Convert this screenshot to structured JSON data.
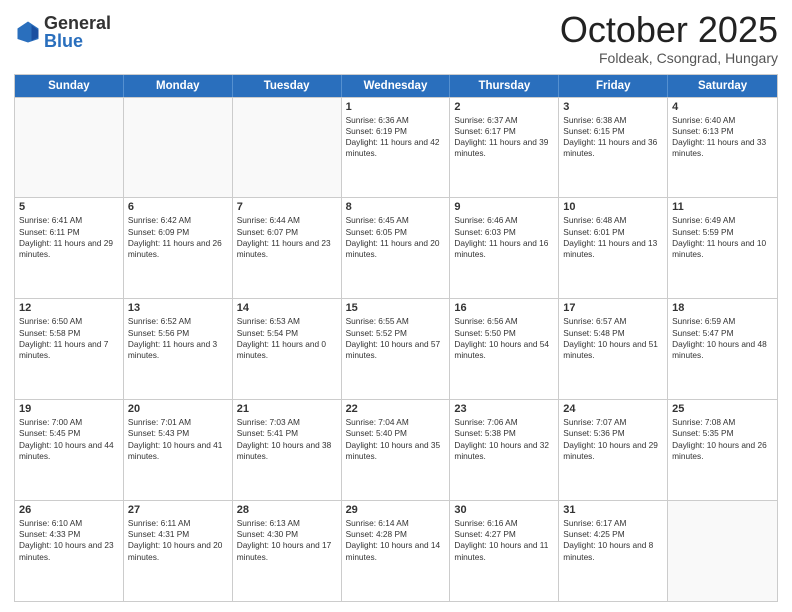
{
  "logo": {
    "general": "General",
    "blue": "Blue"
  },
  "header": {
    "month": "October 2025",
    "location": "Foldeak, Csongrad, Hungary"
  },
  "days": [
    "Sunday",
    "Monday",
    "Tuesday",
    "Wednesday",
    "Thursday",
    "Friday",
    "Saturday"
  ],
  "weeks": [
    [
      {
        "day": "",
        "sunrise": "",
        "sunset": "",
        "daylight": ""
      },
      {
        "day": "",
        "sunrise": "",
        "sunset": "",
        "daylight": ""
      },
      {
        "day": "",
        "sunrise": "",
        "sunset": "",
        "daylight": ""
      },
      {
        "day": "1",
        "sunrise": "Sunrise: 6:36 AM",
        "sunset": "Sunset: 6:19 PM",
        "daylight": "Daylight: 11 hours and 42 minutes."
      },
      {
        "day": "2",
        "sunrise": "Sunrise: 6:37 AM",
        "sunset": "Sunset: 6:17 PM",
        "daylight": "Daylight: 11 hours and 39 minutes."
      },
      {
        "day": "3",
        "sunrise": "Sunrise: 6:38 AM",
        "sunset": "Sunset: 6:15 PM",
        "daylight": "Daylight: 11 hours and 36 minutes."
      },
      {
        "day": "4",
        "sunrise": "Sunrise: 6:40 AM",
        "sunset": "Sunset: 6:13 PM",
        "daylight": "Daylight: 11 hours and 33 minutes."
      }
    ],
    [
      {
        "day": "5",
        "sunrise": "Sunrise: 6:41 AM",
        "sunset": "Sunset: 6:11 PM",
        "daylight": "Daylight: 11 hours and 29 minutes."
      },
      {
        "day": "6",
        "sunrise": "Sunrise: 6:42 AM",
        "sunset": "Sunset: 6:09 PM",
        "daylight": "Daylight: 11 hours and 26 minutes."
      },
      {
        "day": "7",
        "sunrise": "Sunrise: 6:44 AM",
        "sunset": "Sunset: 6:07 PM",
        "daylight": "Daylight: 11 hours and 23 minutes."
      },
      {
        "day": "8",
        "sunrise": "Sunrise: 6:45 AM",
        "sunset": "Sunset: 6:05 PM",
        "daylight": "Daylight: 11 hours and 20 minutes."
      },
      {
        "day": "9",
        "sunrise": "Sunrise: 6:46 AM",
        "sunset": "Sunset: 6:03 PM",
        "daylight": "Daylight: 11 hours and 16 minutes."
      },
      {
        "day": "10",
        "sunrise": "Sunrise: 6:48 AM",
        "sunset": "Sunset: 6:01 PM",
        "daylight": "Daylight: 11 hours and 13 minutes."
      },
      {
        "day": "11",
        "sunrise": "Sunrise: 6:49 AM",
        "sunset": "Sunset: 5:59 PM",
        "daylight": "Daylight: 11 hours and 10 minutes."
      }
    ],
    [
      {
        "day": "12",
        "sunrise": "Sunrise: 6:50 AM",
        "sunset": "Sunset: 5:58 PM",
        "daylight": "Daylight: 11 hours and 7 minutes."
      },
      {
        "day": "13",
        "sunrise": "Sunrise: 6:52 AM",
        "sunset": "Sunset: 5:56 PM",
        "daylight": "Daylight: 11 hours and 3 minutes."
      },
      {
        "day": "14",
        "sunrise": "Sunrise: 6:53 AM",
        "sunset": "Sunset: 5:54 PM",
        "daylight": "Daylight: 11 hours and 0 minutes."
      },
      {
        "day": "15",
        "sunrise": "Sunrise: 6:55 AM",
        "sunset": "Sunset: 5:52 PM",
        "daylight": "Daylight: 10 hours and 57 minutes."
      },
      {
        "day": "16",
        "sunrise": "Sunrise: 6:56 AM",
        "sunset": "Sunset: 5:50 PM",
        "daylight": "Daylight: 10 hours and 54 minutes."
      },
      {
        "day": "17",
        "sunrise": "Sunrise: 6:57 AM",
        "sunset": "Sunset: 5:48 PM",
        "daylight": "Daylight: 10 hours and 51 minutes."
      },
      {
        "day": "18",
        "sunrise": "Sunrise: 6:59 AM",
        "sunset": "Sunset: 5:47 PM",
        "daylight": "Daylight: 10 hours and 48 minutes."
      }
    ],
    [
      {
        "day": "19",
        "sunrise": "Sunrise: 7:00 AM",
        "sunset": "Sunset: 5:45 PM",
        "daylight": "Daylight: 10 hours and 44 minutes."
      },
      {
        "day": "20",
        "sunrise": "Sunrise: 7:01 AM",
        "sunset": "Sunset: 5:43 PM",
        "daylight": "Daylight: 10 hours and 41 minutes."
      },
      {
        "day": "21",
        "sunrise": "Sunrise: 7:03 AM",
        "sunset": "Sunset: 5:41 PM",
        "daylight": "Daylight: 10 hours and 38 minutes."
      },
      {
        "day": "22",
        "sunrise": "Sunrise: 7:04 AM",
        "sunset": "Sunset: 5:40 PM",
        "daylight": "Daylight: 10 hours and 35 minutes."
      },
      {
        "day": "23",
        "sunrise": "Sunrise: 7:06 AM",
        "sunset": "Sunset: 5:38 PM",
        "daylight": "Daylight: 10 hours and 32 minutes."
      },
      {
        "day": "24",
        "sunrise": "Sunrise: 7:07 AM",
        "sunset": "Sunset: 5:36 PM",
        "daylight": "Daylight: 10 hours and 29 minutes."
      },
      {
        "day": "25",
        "sunrise": "Sunrise: 7:08 AM",
        "sunset": "Sunset: 5:35 PM",
        "daylight": "Daylight: 10 hours and 26 minutes."
      }
    ],
    [
      {
        "day": "26",
        "sunrise": "Sunrise: 6:10 AM",
        "sunset": "Sunset: 4:33 PM",
        "daylight": "Daylight: 10 hours and 23 minutes."
      },
      {
        "day": "27",
        "sunrise": "Sunrise: 6:11 AM",
        "sunset": "Sunset: 4:31 PM",
        "daylight": "Daylight: 10 hours and 20 minutes."
      },
      {
        "day": "28",
        "sunrise": "Sunrise: 6:13 AM",
        "sunset": "Sunset: 4:30 PM",
        "daylight": "Daylight: 10 hours and 17 minutes."
      },
      {
        "day": "29",
        "sunrise": "Sunrise: 6:14 AM",
        "sunset": "Sunset: 4:28 PM",
        "daylight": "Daylight: 10 hours and 14 minutes."
      },
      {
        "day": "30",
        "sunrise": "Sunrise: 6:16 AM",
        "sunset": "Sunset: 4:27 PM",
        "daylight": "Daylight: 10 hours and 11 minutes."
      },
      {
        "day": "31",
        "sunrise": "Sunrise: 6:17 AM",
        "sunset": "Sunset: 4:25 PM",
        "daylight": "Daylight: 10 hours and 8 minutes."
      },
      {
        "day": "",
        "sunrise": "",
        "sunset": "",
        "daylight": ""
      }
    ]
  ]
}
